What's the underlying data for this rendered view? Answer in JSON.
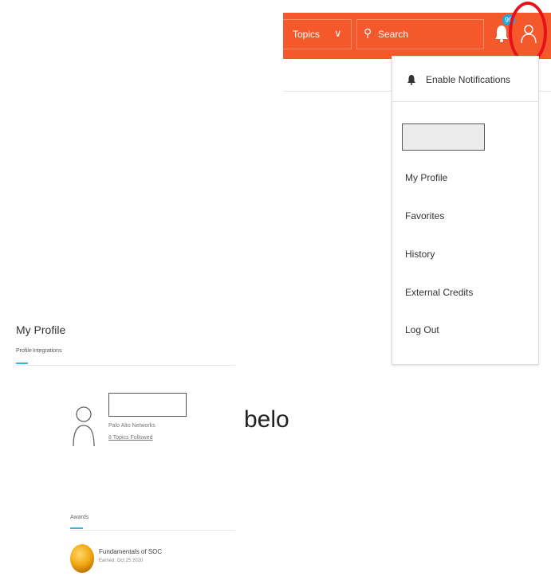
{
  "header": {
    "topics_label": "Topics",
    "search_placeholder": "Search",
    "notification_badge": "99",
    "accent_color": "#f5592b",
    "highlight_color": "#e8101a"
  },
  "menu": {
    "enable_notifications": "Enable Notifications",
    "items": [
      "My Profile",
      "Favorites",
      "History",
      "External Credits",
      "Log Out"
    ]
  },
  "profile": {
    "title": "My Profile",
    "tabs": [
      "Profile",
      "Integrations"
    ],
    "company": "Palo Alto Networks",
    "topics_followed": "8 Topics Followed"
  },
  "annotation": {
    "text": "belo"
  },
  "awards": {
    "title": "Awards",
    "items": [
      {
        "name": "Fundamentals of SOC",
        "earned": "Earned: Oct 25 2020"
      }
    ]
  }
}
